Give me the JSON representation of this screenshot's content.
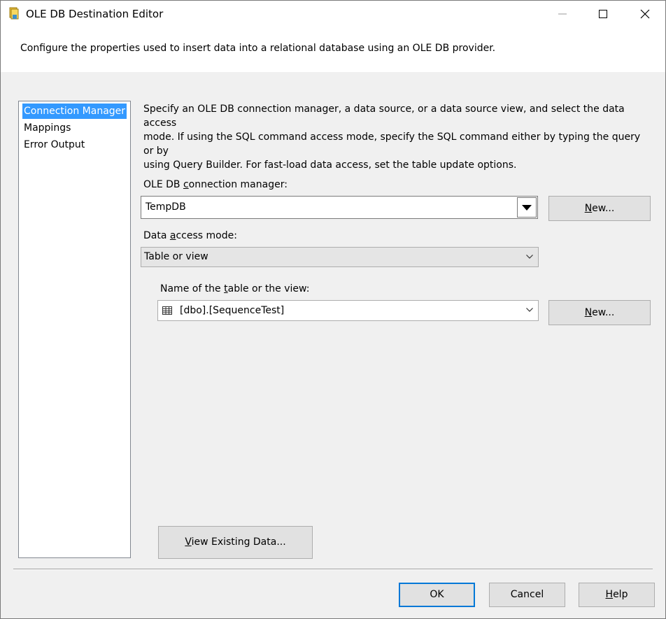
{
  "window": {
    "title": "OLE DB Destination Editor",
    "header_description": "Configure the properties used to insert data into a relational database using an OLE DB provider."
  },
  "nav": {
    "items": [
      {
        "label": "Connection Manager",
        "selected": true
      },
      {
        "label": "Mappings",
        "selected": false
      },
      {
        "label": "Error Output",
        "selected": false
      }
    ]
  },
  "panel": {
    "description_lines": [
      "Specify an OLE DB connection manager, a data source, or a data source view, and select the data access",
      "mode. If using the SQL command access mode, specify the SQL command either by typing the query or by",
      "using Query Builder. For fast-load data access, set the table update options."
    ],
    "connection_manager": {
      "label_pre": "OLE DB ",
      "label_accel": "c",
      "label_post": "onnection manager:",
      "value": "TempDB",
      "new_button": {
        "accel": "N",
        "rest": "ew..."
      }
    },
    "access_mode": {
      "label_pre": "Data ",
      "label_accel": "a",
      "label_post": "ccess mode:",
      "value": "Table or view"
    },
    "table": {
      "label_pre": "Name of the ",
      "label_accel": "t",
      "label_post": "able or the view:",
      "value": "[dbo].[SequenceTest]",
      "new_button": {
        "accel": "N",
        "rest": "ew..."
      }
    },
    "view_data_button": {
      "accel": "V",
      "rest": "iew Existing Data..."
    }
  },
  "footer": {
    "ok_label": "OK",
    "cancel_label": "Cancel",
    "help_button": {
      "accel": "H",
      "rest": "elp"
    }
  },
  "colors": {
    "selection": "#3399ff",
    "default_button_border": "#0078d7",
    "dialog_background": "#f0f0f0"
  },
  "icons": {
    "app": "ssis-destination-icon",
    "minimize": "minimize-icon",
    "maximize": "maximize-icon",
    "close": "close-icon",
    "dropdown": "dropdown-arrow-icon",
    "table": "table-icon"
  }
}
